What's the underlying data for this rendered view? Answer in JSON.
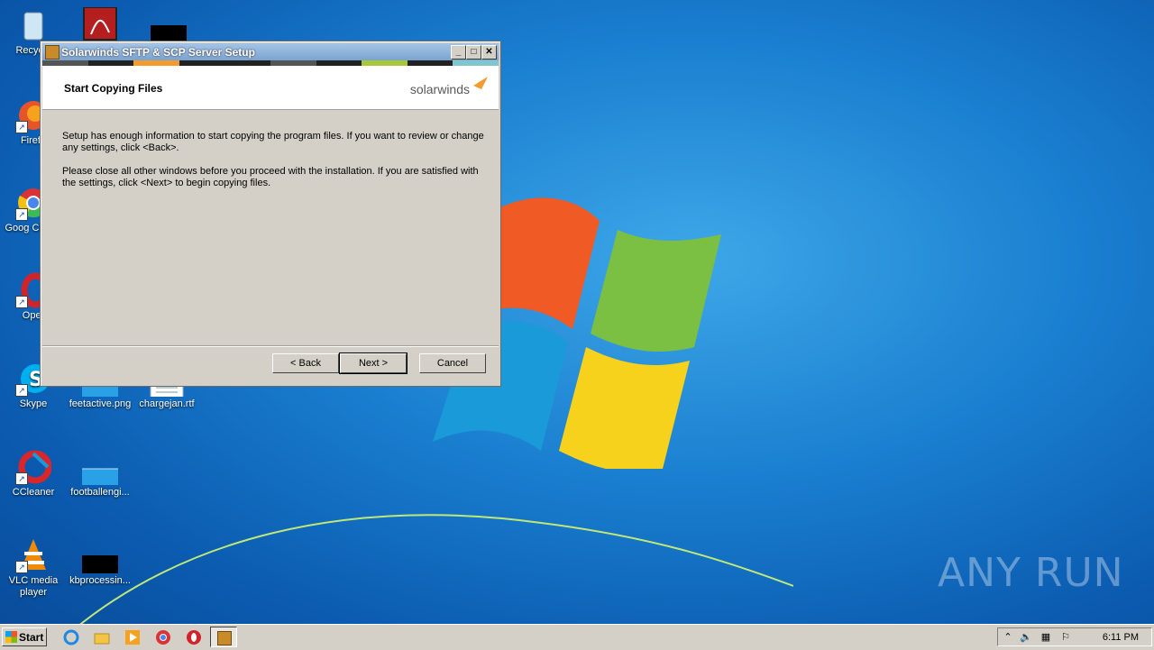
{
  "desktop": {
    "icons": [
      {
        "label": "Recycle",
        "icon": "recycle-bin-icon"
      },
      {
        "label": "Firefo",
        "icon": "firefox-icon"
      },
      {
        "label": "Goog Chrom",
        "icon": "chrome-icon"
      },
      {
        "label": "Oper",
        "icon": "opera-icon"
      },
      {
        "label": "Skype",
        "icon": "skype-icon"
      },
      {
        "label": "feetactive.png",
        "icon": "image-file-icon"
      },
      {
        "label": "chargejan.rtf",
        "icon": "document-file-icon"
      },
      {
        "label": "CCleaner",
        "icon": "ccleaner-icon"
      },
      {
        "label": "footballengi...",
        "icon": "file-icon"
      },
      {
        "label": "VLC media player",
        "icon": "vlc-icon"
      },
      {
        "label": "kbprocessin...",
        "icon": "file-icon"
      }
    ]
  },
  "dialog": {
    "title": "Solarwinds SFTP & SCP Server Setup",
    "header_title": "Start Copying Files",
    "logo_text": "solarwinds",
    "paragraph1": "Setup has enough information to start copying the program files.  If you want to review or change any settings, click <Back>.",
    "paragraph2": "Please close all other windows before you proceed with the installation. If you are satisfied with the settings, click <Next> to begin copying files.",
    "back_label": "< Back",
    "next_label": "Next >",
    "cancel_label": "Cancel",
    "colorbar": [
      "#555555",
      "#222222",
      "#f39c2d",
      "#222222",
      "#222222",
      "#555555",
      "#222222",
      "#a6c83a",
      "#222222",
      "#7fc6cf"
    ]
  },
  "taskbar": {
    "start_label": "Start",
    "clock": "6:11 PM"
  },
  "watermark": "ANY RUN"
}
